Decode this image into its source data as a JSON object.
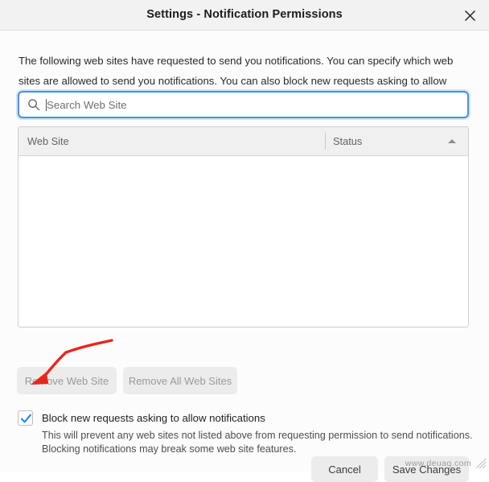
{
  "window": {
    "title": "Settings - Notification Permissions",
    "close_icon": "close-icon"
  },
  "description": "The following web sites have requested to send you notifications. You can specify which web sites are allowed to send you notifications. You can also block new requests asking to allow notifications.",
  "search": {
    "icon": "search-icon",
    "placeholder": "Search Web Site",
    "value": "",
    "focused": true
  },
  "table": {
    "columns": [
      {
        "label": "Web Site",
        "sort": "none"
      },
      {
        "label": "Status",
        "sort": "ascending"
      }
    ],
    "sort_indicator_icon": "triangle-up-icon",
    "rows": [],
    "empty": true
  },
  "actions": {
    "remove_site_label": "Remove Web Site",
    "remove_site_enabled": false,
    "remove_all_label": "Remove All Web Sites",
    "remove_all_enabled": false
  },
  "block_option": {
    "label": "Block new requests asking to allow notifications",
    "checked": true,
    "checkbox_icon": "checkmark-icon",
    "help_line_1": "This will prevent any web sites not listed above from requesting permission to send notifications.",
    "help_line_2": "Blocking notifications may break some web site features."
  },
  "footer": {
    "cancel_label": "Cancel",
    "save_label": "Save Changes"
  },
  "annotation": {
    "type": "curved-arrow",
    "color": "#e8261c",
    "points_to": "block-new-requests-checkbox"
  },
  "watermark": {
    "text": "www.deuaq.com"
  },
  "colors": {
    "accent_blue": "#4a90e2",
    "check_blue": "#2d7ff9",
    "titlebar_bg": "#f2f2f2",
    "body_bg": "#fcfcfc",
    "button_bg": "#ececec",
    "annotation_red": "#e8261c"
  }
}
